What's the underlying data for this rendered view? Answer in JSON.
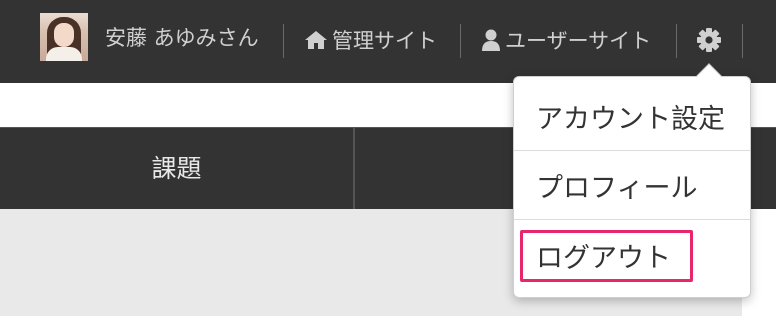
{
  "header": {
    "user_name": "安藤 あゆみさん",
    "admin_site_label": "管理サイト",
    "user_site_label": "ユーザーサイト",
    "icons": [
      "home-icon",
      "user-icon",
      "gear-icon"
    ]
  },
  "tabs": [
    {
      "label": "課題"
    },
    {
      "label": ""
    }
  ],
  "settings_menu": {
    "items": [
      {
        "label": "アカウント設定"
      },
      {
        "label": "プロフィール"
      },
      {
        "label": "ログアウト"
      }
    ],
    "highlight_color": "#e8266b"
  },
  "colors": {
    "header_bg": "#333333",
    "header_text": "#d0d0d0",
    "content_bg": "#e9e9e9"
  }
}
